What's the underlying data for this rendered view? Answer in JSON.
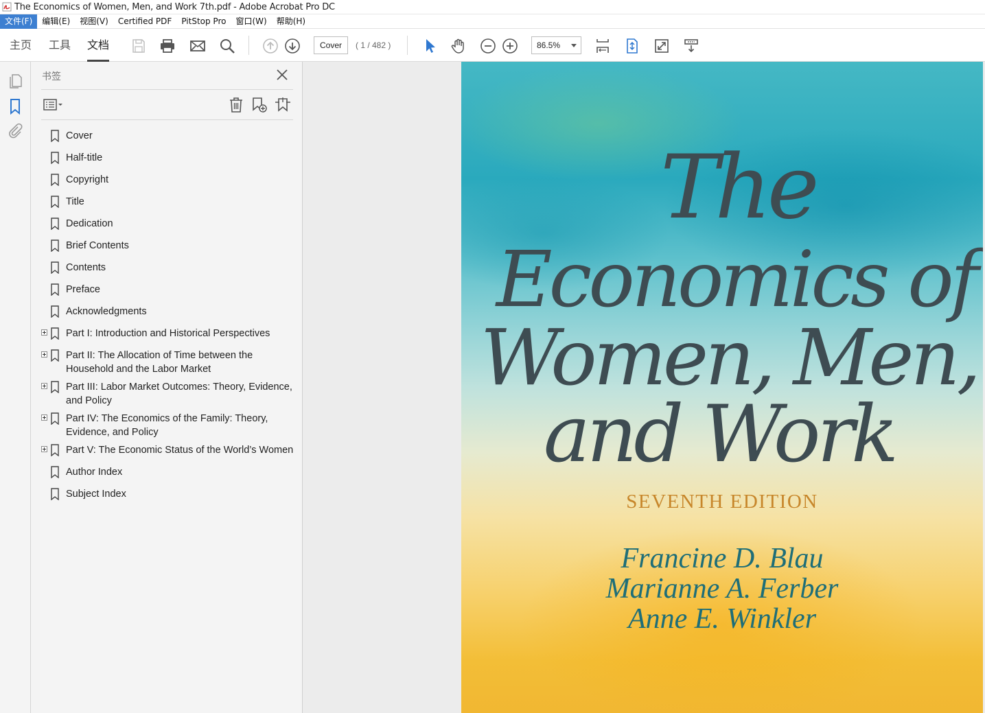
{
  "window": {
    "title": "The Economics of Women, Men, and Work 7th.pdf - Adobe Acrobat Pro DC"
  },
  "menu": [
    "文件(F)",
    "编辑(E)",
    "视图(V)",
    "Certified PDF",
    "PitStop Pro",
    "窗口(W)",
    "帮助(H)"
  ],
  "nav_tabs": [
    "主页",
    "工具",
    "文档"
  ],
  "toolbar": {
    "page_label": "Cover",
    "page_count": "( 1 / 482 )",
    "zoom": "86.5%"
  },
  "bookmarks_panel": {
    "title": "书签",
    "items": [
      {
        "label": "Cover",
        "expandable": false
      },
      {
        "label": "Half-title",
        "expandable": false
      },
      {
        "label": "Copyright",
        "expandable": false
      },
      {
        "label": "Title",
        "expandable": false
      },
      {
        "label": "Dedication",
        "expandable": false
      },
      {
        "label": "Brief Contents",
        "expandable": false
      },
      {
        "label": "Contents",
        "expandable": false
      },
      {
        "label": "Preface",
        "expandable": false
      },
      {
        "label": "Acknowledgments",
        "expandable": false
      },
      {
        "label": "Part I: Introduction and Historical Perspectives",
        "expandable": true
      },
      {
        "label": "Part II: The Allocation of Time between the Household and the Labor Market",
        "expandable": true
      },
      {
        "label": "Part III: Labor Market Outcomes: Theory, Evidence, and Policy",
        "expandable": true
      },
      {
        "label": "Part IV: The Economics of the Family: Theory, Evidence, and Policy",
        "expandable": true
      },
      {
        "label": "Part V: The Economic Status of the World’s Women",
        "expandable": true
      },
      {
        "label": "Author Index",
        "expandable": false
      },
      {
        "label": "Subject Index",
        "expandable": false
      }
    ]
  },
  "cover": {
    "line1": "The",
    "line2": "Economics of",
    "line3": "Women, Men,",
    "line4": "and Work",
    "edition": "SEVENTH EDITION",
    "authors": [
      "Francine D. Blau",
      "Marianne A. Ferber",
      "Anne E. Winkler"
    ]
  },
  "colors": {
    "accent": "#3c7fd1",
    "select_tool": "#2f78d0",
    "cover_title": "#3e4c52",
    "cover_edition": "#c7862a",
    "cover_authors": "#1e6e78"
  }
}
